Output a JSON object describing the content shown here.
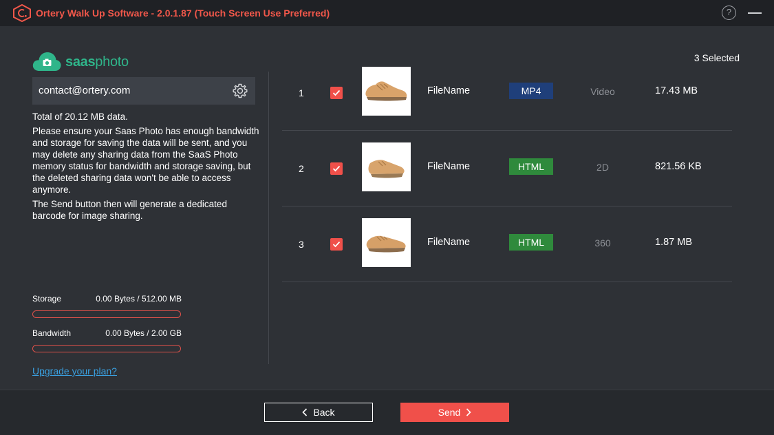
{
  "window": {
    "title": "Ortery Walk Up Software - 2.0.1.87 (Touch Screen Use Preferred)",
    "help_label": "?"
  },
  "brand": {
    "text_bold": "saas",
    "text_light": "photo",
    "color": "#2fb58a"
  },
  "account": {
    "email": "contact@ortery.com"
  },
  "info": {
    "total": "Total of 20.12 MB data.",
    "paragraph1": "Please ensure your Saas Photo has enough bandwidth and storage for saving the data will be sent, and you may delete any sharing data from the SaaS Photo memory status for bandwidth and storage saving, but the deleted sharing data won't be able to access anymore.",
    "paragraph2": "The Send button then will generate a dedicated barcode for image sharing."
  },
  "usage": {
    "storage_label": "Storage",
    "storage_value": "0.00 Bytes / 512.00 MB",
    "storage_fraction": 0,
    "bandwidth_label": "Bandwidth",
    "bandwidth_value": "0.00 Bytes / 2.00 GB",
    "bandwidth_fraction": 0
  },
  "upgrade_link": "Upgrade your plan?",
  "list": {
    "selected_count": "3 Selected",
    "items": [
      {
        "index": "1",
        "checked": true,
        "name": "FileName",
        "format": "MP4",
        "format_color": "#1f3f7a",
        "type": "Video",
        "size": "17.43 MB"
      },
      {
        "index": "2",
        "checked": true,
        "name": "FileName",
        "format": "HTML",
        "format_color": "#2f8a3c",
        "type": "2D",
        "size": "821.56 KB"
      },
      {
        "index": "3",
        "checked": true,
        "name": "FileName",
        "format": "HTML",
        "format_color": "#2f8a3c",
        "type": "360",
        "size": "1.87 MB"
      }
    ]
  },
  "footer": {
    "back_label": "Back",
    "send_label": "Send"
  },
  "colors": {
    "accent": "#f0504a",
    "link": "#3aa0e0",
    "background": "#2e3136"
  }
}
